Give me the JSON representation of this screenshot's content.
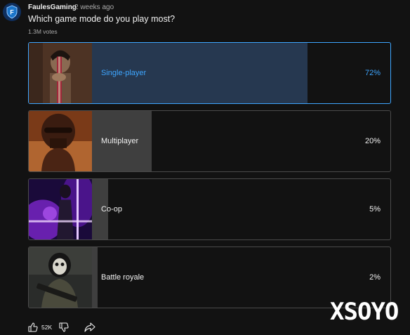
{
  "post": {
    "channel": "FaulesGaming",
    "time": "2 weeks ago",
    "avatar_letter": "F",
    "question": "Which game mode do you play most?",
    "votes": "1.3M votes"
  },
  "poll": {
    "options": [
      {
        "label": "Single-player",
        "percent_text": "72%",
        "percent": 72,
        "selected": true,
        "thumb_icon": "samurai-thumbnail"
      },
      {
        "label": "Multiplayer",
        "percent_text": "20%",
        "percent": 20,
        "selected": false,
        "thumb_icon": "helmet-soldier-thumbnail"
      },
      {
        "label": "Co-op",
        "percent_text": "5%",
        "percent": 5,
        "selected": false,
        "thumb_icon": "neon-warrior-thumbnail"
      },
      {
        "label": "Battle royale",
        "percent_text": "2%",
        "percent": 2,
        "selected": false,
        "thumb_icon": "skull-mask-soldier-thumbnail"
      }
    ]
  },
  "actions": {
    "likes": "52K",
    "icons": [
      "like-icon",
      "dislike-icon",
      "share-icon"
    ]
  },
  "watermark": "XSOYO",
  "colors": {
    "background": "#121212",
    "accent": "#3ea6ff",
    "selected_fill": "#263850",
    "bar_fill": "#3f3f3f",
    "border": "#4b4b4b"
  }
}
